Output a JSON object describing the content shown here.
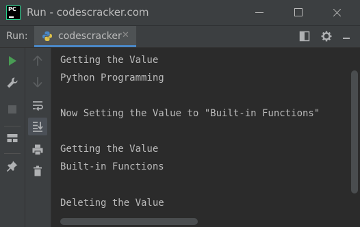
{
  "window": {
    "title": "Run - codescracker.com",
    "app_icon_text": "PC"
  },
  "run_panel": {
    "label": "Run:",
    "tab": {
      "label": "codescracker",
      "close_glyph": "✕",
      "icon": "python-icon"
    },
    "header_icons": [
      "layout-icon",
      "gear-icon",
      "minimize-panel-icon"
    ]
  },
  "toolbar": {
    "left_icons": [
      "rerun-play-icon",
      "wrench-icon",
      "stop-icon",
      "layout-grid-icon",
      "pin-icon"
    ],
    "right_icons": [
      "up-arrow-icon",
      "down-arrow-icon",
      "soft-wrap-icon",
      "scroll-to-end-icon",
      "print-icon",
      "trash-icon"
    ]
  },
  "console": {
    "lines": [
      "Getting the Value",
      "Python Programming",
      "",
      "Now Setting the Value to \"Built-in Functions\"",
      "",
      "Getting the Value",
      "Built-in Functions",
      "",
      "Deleting the Value"
    ]
  },
  "colors": {
    "background": "#2b2b2b",
    "panel": "#3c3f41",
    "text": "#bbbbbb",
    "run_green": "#499c54",
    "tab_underline": "#4a88c7"
  }
}
